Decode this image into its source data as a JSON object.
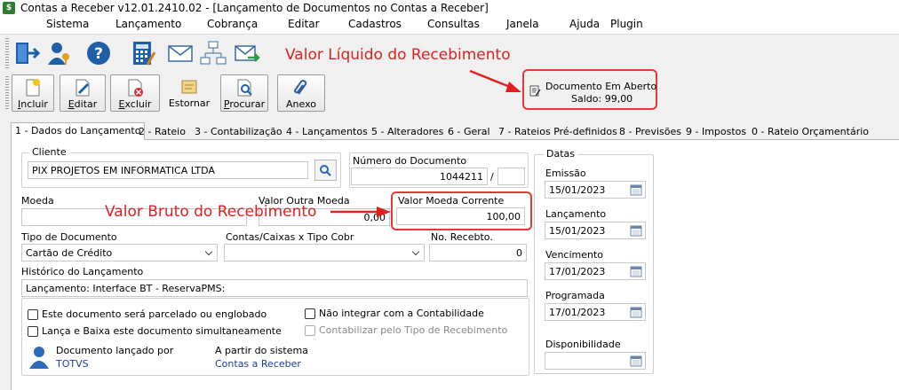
{
  "window": {
    "title": "Contas a Receber v12.01.2410.02 - [Lançamento de Documentos no Contas a Receber]"
  },
  "menu": [
    "Sistema",
    "Lançamento",
    "Cobrança",
    "Editar",
    "Cadastros",
    "Consultas",
    "Janela",
    "Ajuda",
    "Plugin"
  ],
  "toolbar": {
    "incluir": "ncluir",
    "incluir_u": "I",
    "editar": "ditar",
    "editar_u": "E",
    "excluir": "xcluir",
    "excluir_u": "E",
    "estornar": "Estornar",
    "procurar": "rocurar",
    "procurar_u": "P",
    "anexo": "Anexo"
  },
  "annotations": {
    "liquido": "Valor Líquido do Recebimento",
    "bruto": "Valor Bruto do Recebimento",
    "color": "#e02020"
  },
  "status": {
    "title": "Documento Em Aberto",
    "saldo": "Saldo: 99,00"
  },
  "tabs": [
    "1 - Dados do Lançamento",
    "2 - Rateio",
    "3 - Contabilização",
    "4 - Lançamentos",
    "5 - Alteradores",
    "6 - Geral",
    "7 - Rateios Pré-definidos",
    "8 - Previsões",
    "9 - Impostos",
    "0 - Rateio Orçamentário"
  ],
  "form": {
    "cliente_label": "Cliente",
    "cliente_value": "PIX PROJETOS EM INFORMATICA LTDA",
    "numero_doc_label": "Número do Documento",
    "numero_doc_value": "1044211",
    "numero_doc_sep": "/",
    "moeda_label": "Moeda",
    "valor_outra_label": "Valor Outra Moeda",
    "valor_outra_value": "0,00",
    "valor_corrente_label": "Valor Moeda Corrente",
    "valor_corrente_value": "100,00",
    "tipo_doc_label": "Tipo de Documento",
    "tipo_doc_value": "Cartão de Crédito",
    "contas_label": "Contas/Caixas x Tipo Cobr",
    "no_recebto_label": "No. Recebto.",
    "no_recebto_value": "0",
    "historico_label": "Histórico do Lançamento",
    "historico_value": "Lançamento: Interface BT - ReservaPMS:",
    "chk_parcelado": "Este documento será parcelado ou englobado",
    "chk_baixa": "Lança e Baixa este documento simultaneamente",
    "chk_contabilidade": "Não integrar com a Contabilidade",
    "chk_contabilizar": "Contabilizar pelo Tipo de Recebimento",
    "lancado_por_label": "Documento lançado por",
    "lancado_por_value": "TOTVS",
    "sistema_label": "A partir do sistema",
    "sistema_value": "Contas a Receber"
  },
  "datas": {
    "title": "Datas",
    "emissao_label": "Emissão",
    "emissao": "15/01/2023",
    "lancamento_label": "Lançamento",
    "lancamento": "15/01/2023",
    "vencimento_label": "Vencimento",
    "vencimento": "17/01/2023",
    "programada_label": "Programada",
    "programada": "17/01/2023",
    "disponibilidade_label": "Disponibilidade",
    "disponibilidade": ""
  }
}
